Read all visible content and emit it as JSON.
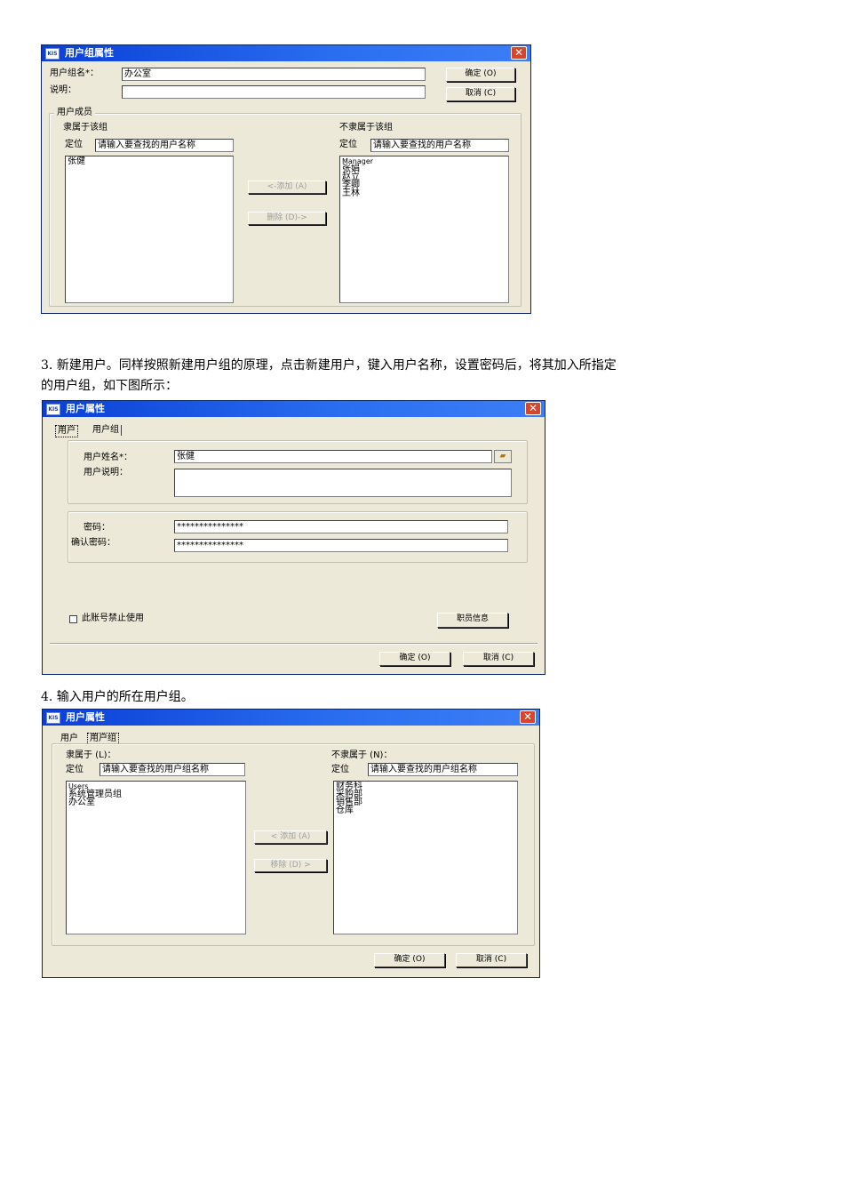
{
  "dialog1": {
    "logo": "KIS",
    "title": "用户组属性",
    "group_name_label": "用户组名*：",
    "group_name_value": "办公室",
    "desc_label": "说明：",
    "desc_value": "",
    "ok_label": "确定 (O)",
    "cancel_label": "取消 (C)",
    "members_legend": "用户成员",
    "member_title": "隶属于该组",
    "nonmember_title": "不隶属于该组",
    "locate_label": "定位",
    "search_placeholder": "请输入要查找的用户名称",
    "members": [
      "张健"
    ],
    "nonmembers": [
      "Manager",
      "张娟",
      "赵立",
      "李卿",
      "王林"
    ],
    "add_label": "<-添加 (A)",
    "remove_label": "删除 (D)->"
  },
  "paragraph1": {
    "line1": "3. 新建用户。同样按照新建用户组的原理，点击新建用户，键入用户名称，设置密码后，将其加入所指定",
    "line2": "的用户组，如下图所示："
  },
  "dialog2": {
    "logo": "KIS",
    "title": "用户属性",
    "tabs": [
      "用户",
      "用户组"
    ],
    "username_label": "用户姓名*：",
    "username_value": "张健",
    "userdesc_label": "用户说明：",
    "userdesc_value": "",
    "password_label": "密码：",
    "password_value": "***************",
    "confirm_label": "确认密码：",
    "confirm_value": "***************",
    "disable_label": "此账号禁止使用",
    "staff_btn": "职员信息",
    "ok_label": "确定 (O)",
    "cancel_label": "取消 (C)"
  },
  "paragraph2": {
    "line1": "4. 输入用户的所在用户组。"
  },
  "dialog3": {
    "logo": "KIS",
    "title": "用户属性",
    "tabs": [
      "用户",
      "用户组"
    ],
    "member_title": "隶属于 (L)：",
    "nonmember_title": "不隶属于 (N)：",
    "locate_label": "定位",
    "search_placeholder": "请输入要查找的用户组名称",
    "members": [
      "Users",
      "系统管理员组",
      "办公室"
    ],
    "nonmembers": [
      "财务科",
      "采购部",
      "销售部",
      "仓库"
    ],
    "add_label": "< 添加 (A)",
    "remove_label": "移除 (D) >",
    "ok_label": "确定 (O)",
    "cancel_label": "取消 (C)"
  }
}
